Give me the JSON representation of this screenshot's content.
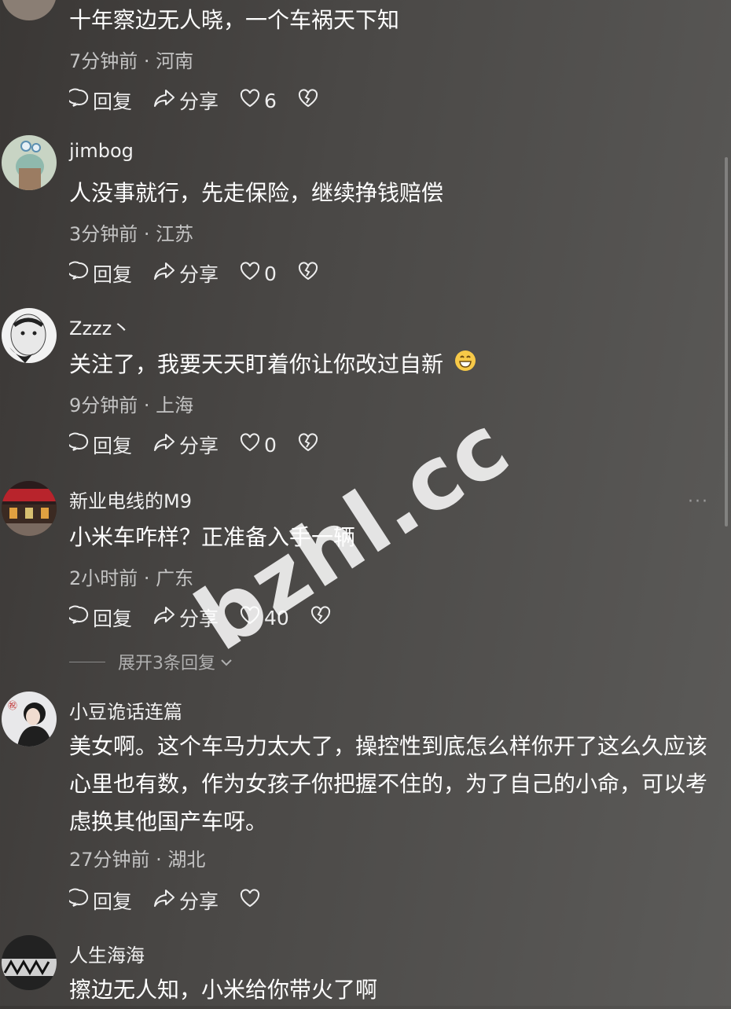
{
  "comments": [
    {
      "username": "",
      "text": "十年察边无人晓，一个车祸天下知",
      "meta": "7分钟前 · 河南",
      "reply": "回复",
      "share": "分享",
      "likes": "6"
    },
    {
      "username": "jimbog",
      "text": "人没事就行，先走保险，继续挣钱赔偿",
      "meta": "3分钟前 · 江苏",
      "reply": "回复",
      "share": "分享",
      "likes": "0"
    },
    {
      "username": "Zzzz丶",
      "text": "关注了，我要天天盯着你让你改过自新",
      "meta": "9分钟前 · 上海",
      "reply": "回复",
      "share": "分享",
      "likes": "0"
    },
    {
      "username": "新业电线的M9",
      "text": "小米车咋样？正准备入手一辆",
      "meta": "2小时前 · 广东",
      "reply": "回复",
      "share": "分享",
      "likes": "40",
      "more": "···",
      "expand": "展开3条回复"
    },
    {
      "username": "小豆诡话连篇",
      "text": "美女啊。这个车马力太大了，操控性到底怎么样你开了这么久应该心里也有数，作为女孩子你把握不住的，为了自己的小命，可以考虑换其他国产车呀。",
      "meta": "27分钟前 · 湖北",
      "reply": "回复",
      "share": "分享",
      "likes": ""
    },
    {
      "username": "人生海海",
      "text": "擦边无人知，小米给你带火了啊"
    }
  ],
  "watermark": "bzhl.cc",
  "colors": {
    "background": "#4a4846",
    "text": "#ffffff",
    "meta": "#c4c4c4"
  }
}
